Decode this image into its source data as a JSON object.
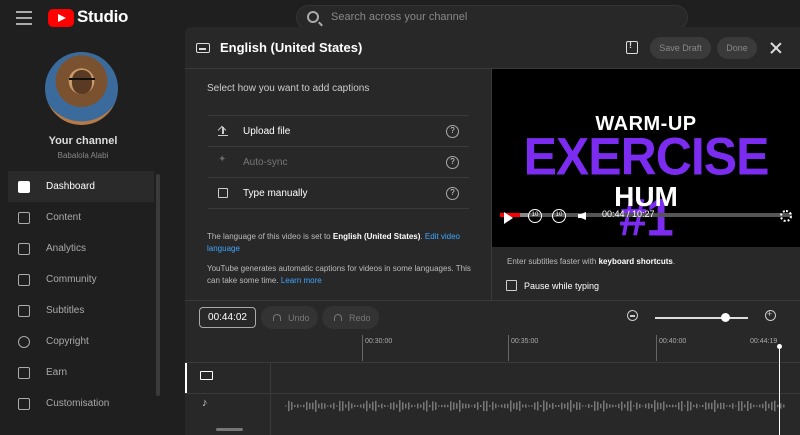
{
  "app": {
    "brand": "Studio"
  },
  "search": {
    "placeholder": "Search across your channel"
  },
  "channel": {
    "title": "Your channel",
    "name": "Babalola Alabi"
  },
  "sidebar": {
    "items": [
      {
        "label": "Dashboard",
        "icon": "dashboard-icon",
        "active": true
      },
      {
        "label": "Content",
        "icon": "content-icon"
      },
      {
        "label": "Analytics",
        "icon": "analytics-icon"
      },
      {
        "label": "Community",
        "icon": "community-icon"
      },
      {
        "label": "Subtitles",
        "icon": "subtitles-icon"
      },
      {
        "label": "Copyright",
        "icon": "copyright-icon"
      },
      {
        "label": "Earn",
        "icon": "earn-icon"
      },
      {
        "label": "Customisation",
        "icon": "customisation-icon"
      }
    ]
  },
  "modal": {
    "title": "English (United States)",
    "save_draft": "Save Draft",
    "done": "Done",
    "heading": "Select how you want to add captions",
    "options": [
      {
        "label": "Upload file",
        "icon": "upload-icon",
        "enabled": true
      },
      {
        "label": "Auto-sync",
        "icon": "sparkle-icon",
        "enabled": false
      },
      {
        "label": "Type manually",
        "icon": "keyboard-icon",
        "enabled": true
      }
    ],
    "help_glyph": "?",
    "lang_note_prefix": "The language of this video is set to ",
    "lang_note_lang": "English (United States)",
    "lang_note_suffix": ". ",
    "lang_note_link": "Edit video language",
    "auto_note": "YouTube generates automatic captions for videos in some languages. This can take some time. ",
    "auto_note_link": "Learn more"
  },
  "player": {
    "line1": "WARM-UP",
    "line2": "EXERCISE #1",
    "line3": "HUM",
    "time": "00:44 / 10:27",
    "rewind_label": "10",
    "forward_label": "10",
    "progress_fraction": 0.07
  },
  "shortcuts": {
    "prefix": "Enter subtitles faster with ",
    "link": "keyboard shortcuts",
    "suffix": "."
  },
  "pause_while_typing": "Pause while typing",
  "timeline": {
    "timecode": "00:44:02",
    "undo": "Undo",
    "redo": "Redo",
    "ticks": [
      "00:30:00",
      "00:35:00",
      "00:40:00",
      "00:44:19"
    ]
  },
  "colors": {
    "accent": "#3ea6ff",
    "brand": "#ff0000",
    "title_purple": "#7b2cf0"
  }
}
